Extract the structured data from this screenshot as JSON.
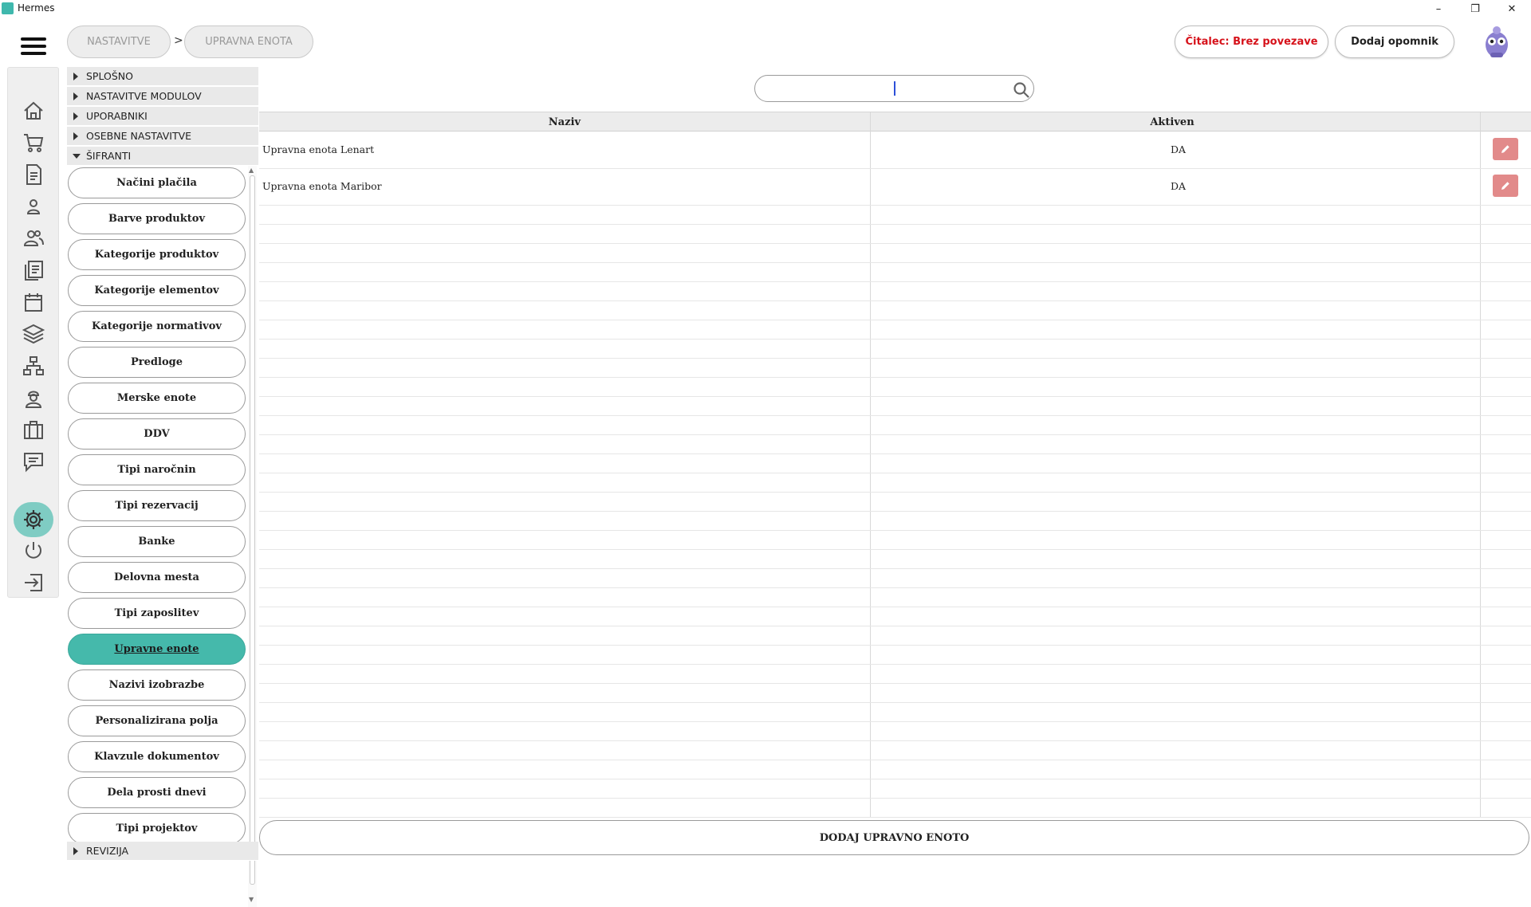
{
  "window": {
    "title": "Hermes",
    "minimize": "–",
    "restore": "❐",
    "close": "✕"
  },
  "breadcrumb": {
    "items": [
      "NASTAVITVE",
      "UPRAVNA ENOTA"
    ],
    "separator": ">"
  },
  "header": {
    "reader_button": "Čitalec: Brez povezave",
    "reminder_button": "Dodaj opomnik"
  },
  "rail": {
    "icons": [
      "home-icon",
      "cart-icon",
      "document-icon",
      "person-icon",
      "people-icon",
      "documents-icon",
      "calendar-icon",
      "layers-icon",
      "sitemap-icon",
      "worker-icon",
      "briefcase-icon",
      "chat-icon",
      "gear-icon",
      "power-icon",
      "logout-icon"
    ],
    "active": "gear-icon",
    "active_color": "#7fccc3"
  },
  "tree": {
    "sections": [
      {
        "label": "SPLOŠNO",
        "expanded": false
      },
      {
        "label": "NASTAVITVE MODULOV",
        "expanded": false
      },
      {
        "label": "UPORABNIKI",
        "expanded": false
      },
      {
        "label": "OSEBNE NASTAVITVE",
        "expanded": false
      },
      {
        "label": "ŠIFRANTI",
        "expanded": true
      }
    ],
    "items": [
      "Načini plačila",
      "Barve produktov",
      "Kategorije produktov",
      "Kategorije elementov",
      "Kategorije normativov",
      "Predloge",
      "Merske enote",
      "DDV",
      "Tipi naročnin",
      "Tipi rezervacij",
      "Banke",
      "Delovna mesta",
      "Tipi zaposlitev",
      "Upravne enote",
      "Nazivi izobrazbe",
      "Personalizirana polja",
      "Klavzule dokumentov",
      "Dela prosti dnevi",
      "Tipi projektov"
    ],
    "active_item": "Upravne enote",
    "footer_section": {
      "label": "REVIZIJA",
      "expanded": false
    },
    "accent": "#45b9ab"
  },
  "search": {
    "value": "",
    "placeholder": ""
  },
  "table": {
    "columns": [
      "Naziv",
      "Aktiven"
    ],
    "rows": [
      {
        "naziv": "Upravna enota Lenart",
        "aktiven": "DA"
      },
      {
        "naziv": "Upravna enota Maribor",
        "aktiven": "DA"
      }
    ],
    "edit_color": "#e28a8a"
  },
  "footer": {
    "add_button": "DODAJ UPRAVNO ENOTO"
  }
}
